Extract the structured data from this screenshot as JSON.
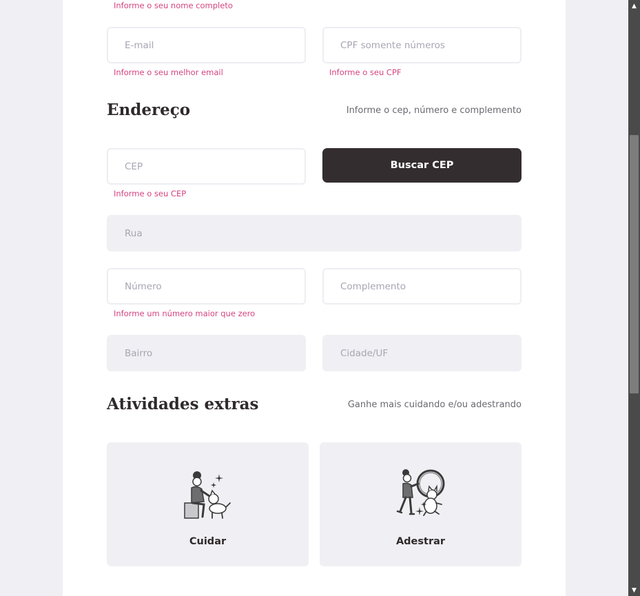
{
  "personal": {
    "name_hint": "Informe o seu nome completo",
    "email_placeholder": "E-mail",
    "email_hint": "Informe o seu melhor email",
    "cpf_placeholder": "CPF somente números",
    "cpf_hint": "Informe o seu CPF"
  },
  "address": {
    "title": "Endereço",
    "subtitle": "Informe o cep, número e complemento",
    "cep_placeholder": "CEP",
    "cep_hint": "Informe o seu CEP",
    "search_cep_button": "Buscar CEP",
    "street_placeholder": "Rua",
    "number_placeholder": "Número",
    "number_hint": "Informe um número maior que zero",
    "complement_placeholder": "Complemento",
    "district_placeholder": "Bairro",
    "city_placeholder": "Cidade/UF"
  },
  "extras": {
    "title": "Atividades extras",
    "subtitle": "Ganhe mais cuidando e/ou adestrando",
    "cards": [
      {
        "label": "Cuidar",
        "icon": "pet-care-icon"
      },
      {
        "label": "Adestrar",
        "icon": "dog-training-icon"
      }
    ]
  },
  "colors": {
    "accent_error": "#d3437f",
    "button_dark": "#342d2f",
    "field_disabled": "#f0eff3"
  }
}
